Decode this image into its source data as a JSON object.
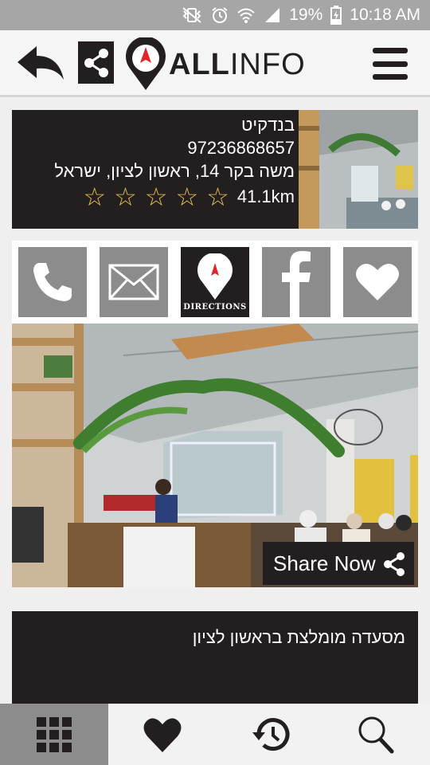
{
  "status_bar": {
    "battery": "19%",
    "time": "10:18 AM"
  },
  "header": {
    "logo_part1": "ALL",
    "logo_part2": "INFO"
  },
  "business": {
    "name": "בנדקיט",
    "phone": "97236868657",
    "address": "משה בקר 14, ראשון לציון, ישראל",
    "rating": 0,
    "rating_max": 5,
    "distance": "41.1km"
  },
  "actions": {
    "directions_label": "DIRECTIONS"
  },
  "share_now_label": "Share Now",
  "description": "מסעדה מומלצת בראשון לציון",
  "colors": {
    "dark": "#231f20",
    "gray_button": "#8c8c8c",
    "star": "#e6c24b",
    "logo_red": "#e0262b",
    "status_bar": "#a6a6a6"
  }
}
